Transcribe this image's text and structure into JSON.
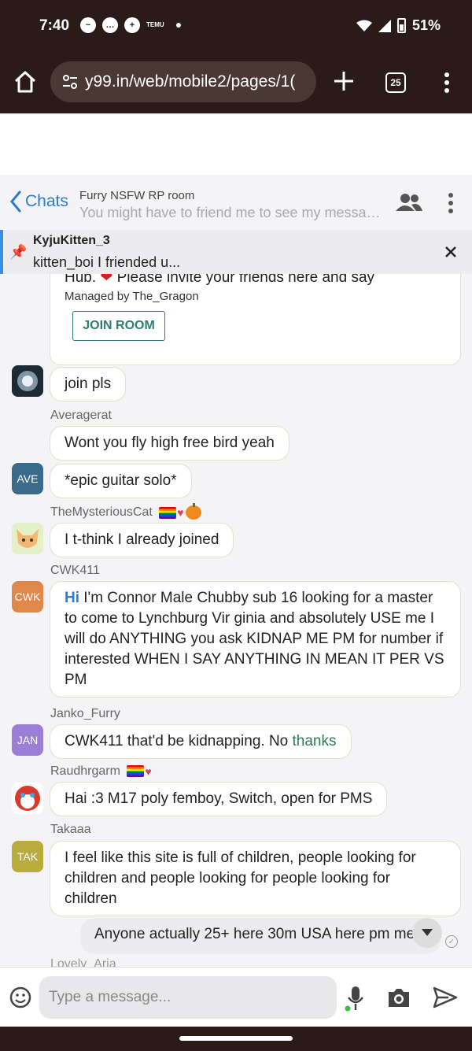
{
  "status_bar": {
    "time": "7:40",
    "battery": "51%",
    "temu_label": "TEMU"
  },
  "browser": {
    "url": "y99.in/web/mobile2/pages/1(",
    "tab_count": "25"
  },
  "chat_header": {
    "back_label": "Chats",
    "room_name": "Furry NSFW RP room",
    "room_subtitle": "You might have to friend me to see my messages"
  },
  "pinned": {
    "user": "KyjuKitten_3",
    "text": "kitten_boi I friended u..."
  },
  "room_card": {
    "line1_before": "Hub.",
    "line1_after": "Please invite your friends here and say",
    "managed_by": "Managed by The_Gragon",
    "join_label": "JOIN ROOM"
  },
  "messages": [
    {
      "username": "",
      "avatar_text": "",
      "text": "join pls"
    },
    {
      "username": "Averagerat",
      "avatar_text": "AVE",
      "text": "Wont you fly high free bird yeah",
      "text2": "*epic guitar solo*"
    },
    {
      "username": "TheMysteriousCat",
      "avatar_text": "",
      "text": "I t-think I already joined"
    },
    {
      "username": "CWK411",
      "avatar_text": "CWK",
      "mention": "Hi",
      "text": "I'm Connor Male Chubby sub 16 looking for a master to come to Lynchburg Vir ginia and absolutely USE me I will do ANYTHING you ask KIDNAP ME PM for number if interested WHEN I SAY ANYTHING IN MEAN IT PER VS PM"
    },
    {
      "username": "Janko_Furry",
      "avatar_text": "JAN",
      "text": "CWK411 that'd be kidnapping. No",
      "highlight": "thanks"
    },
    {
      "username": "Raudhrgarm",
      "avatar_text": "",
      "text": "Hai :3 M17 poly femboy, Switch, open for PMS"
    },
    {
      "username": "Takaaa",
      "avatar_text": "TAK",
      "text": "I feel like this site is full of children, people looking for children and people looking for people looking for children"
    }
  ],
  "outgoing": {
    "text": "Anyone actually 25+ here 30m USA here pm me"
  },
  "next_username": "Lovely_Aria",
  "composer": {
    "placeholder": "Type a message..."
  },
  "colors": {
    "chrome": "#2a1b19",
    "accent_blue": "#2b7cd3",
    "join_green": "#2e7d73",
    "avatar_ave": "#3a6b8c",
    "avatar_cwk": "#e0874a",
    "avatar_jan": "#9b7fd6",
    "avatar_tak": "#b8ac3c"
  }
}
